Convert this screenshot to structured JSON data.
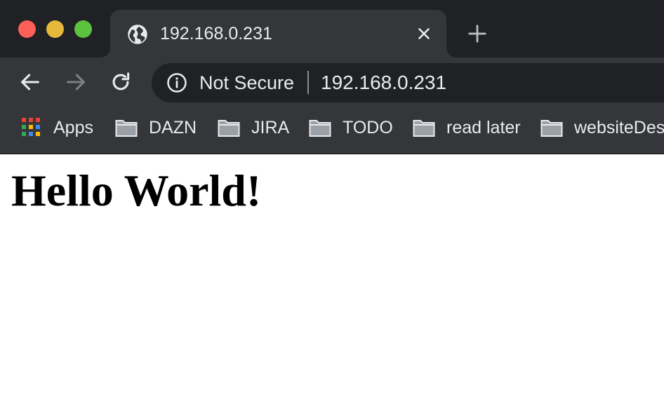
{
  "window": {
    "controls": [
      "close",
      "minimize",
      "maximize"
    ],
    "control_colors": {
      "close": "#fe5f57",
      "minimize": "#febc2e",
      "maximize": "#28c840"
    }
  },
  "tab": {
    "favicon": "globe-icon",
    "title": "192.168.0.231",
    "close_icon": "close-icon"
  },
  "new_tab_icon": "plus-icon",
  "toolbar": {
    "back_icon": "arrow-left-icon",
    "forward_icon": "arrow-right-icon",
    "forward_enabled": false,
    "reload_icon": "reload-icon",
    "security_icon": "info-icon",
    "security_label": "Not Secure",
    "url": "192.168.0.231"
  },
  "bookmarks": [
    {
      "label": "Apps",
      "icon": "apps-grid-icon"
    },
    {
      "label": "DAZN",
      "icon": "folder-icon"
    },
    {
      "label": "JIRA",
      "icon": "folder-icon"
    },
    {
      "label": "TODO",
      "icon": "folder-icon"
    },
    {
      "label": "read later",
      "icon": "folder-icon"
    },
    {
      "label": "websiteDesi",
      "icon": "folder-icon"
    }
  ],
  "page": {
    "heading": "Hello World!"
  },
  "colors": {
    "tabstrip_bg": "#202124",
    "toolbar_bg": "#35363a",
    "omnibox_bg": "#202124",
    "text": "#e8eaed",
    "icon": "#e8eaed",
    "icon_disabled": "#7c7f84",
    "page_bg": "#ffffff"
  }
}
